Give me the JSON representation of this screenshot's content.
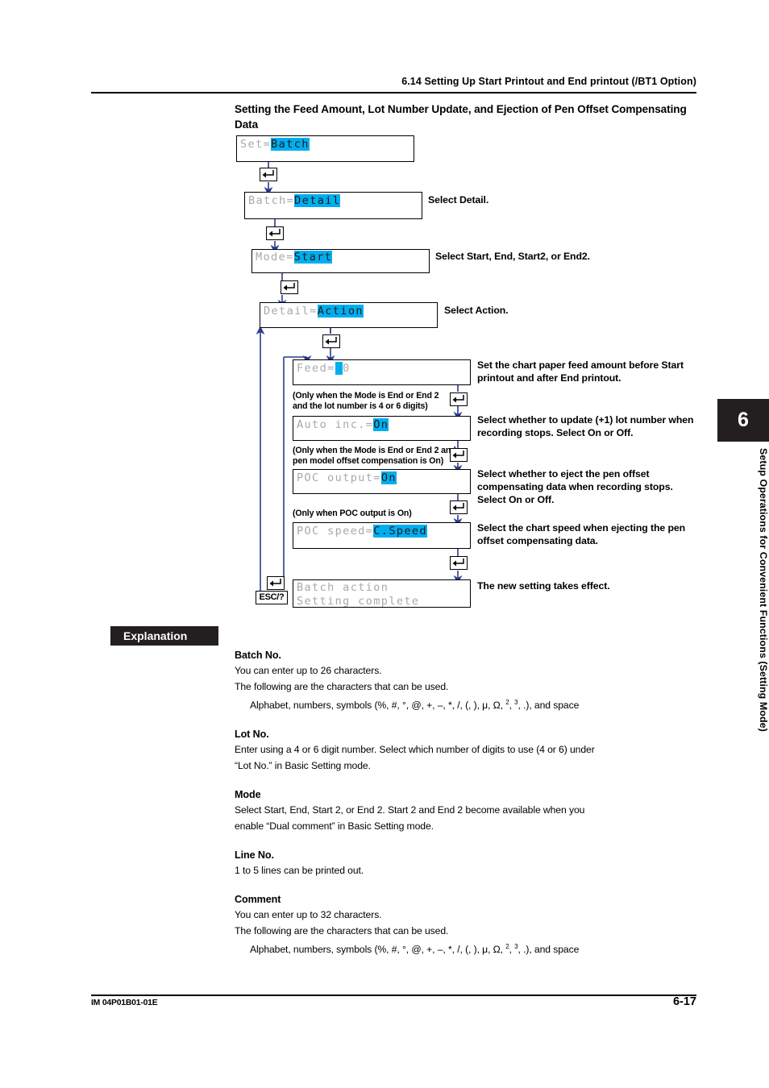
{
  "header": {
    "title": "6.14  Setting Up Start Printout and End printout (/BT1 Option)"
  },
  "section": {
    "title": "Setting the Feed Amount, Lot Number Update, and Ejection of Pen Offset Compensating Data"
  },
  "flow": {
    "steps": [
      {
        "id": "set",
        "lcd_prefix": "Set=",
        "lcd_value": "Batch",
        "callout": ""
      },
      {
        "id": "batch",
        "lcd_prefix": "Batch=",
        "lcd_value": "Detail",
        "callout": "Select Detail."
      },
      {
        "id": "mode",
        "lcd_prefix": "Mode=",
        "lcd_value": "Start",
        "callout": "Select Start, End, Start2, or End2."
      },
      {
        "id": "detail",
        "lcd_prefix": "Detail=",
        "lcd_value": "Action",
        "callout": "Select Action."
      },
      {
        "id": "feed",
        "lcd_prefix": "Feed=",
        "lcd_cursor": " ",
        "lcd_suffix": "0",
        "callout": "Set the chart paper feed amount before Start printout and after End printout."
      },
      {
        "id": "auto-inc",
        "lcd_prefix": "Auto inc.=",
        "lcd_value": "On",
        "note": "(Only when the Mode is End or End 2 and the lot number is 4 or 6 digits)",
        "callout": "Select whether to update (+1) lot number when recording stops. Select On or Off."
      },
      {
        "id": "poc-output",
        "lcd_prefix": "POC output=",
        "lcd_value": "On",
        "note": "(Only when the Mode is End or End 2 and pen model offset compensation is On)",
        "callout": "Select whether to eject the pen offset compensating data when recording stops. Select On or Off."
      },
      {
        "id": "poc-speed",
        "lcd_prefix": "POC speed=",
        "lcd_value": "C.Speed",
        "note": "(Only when POC output is On)",
        "callout": "Select the chart speed when ejecting the pen offset compensating data."
      },
      {
        "id": "complete",
        "lcd_line1": "Batch action",
        "lcd_line2": "Setting complete",
        "callout": "The new setting takes effect."
      }
    ],
    "esc_key_label": "ESC/?",
    "enter_key_name": "enter-key",
    "highlight_color": "#00aeef"
  },
  "explanation": {
    "tag": "Explanation",
    "blocks": [
      {
        "heading": "Batch No.",
        "lines": [
          "You can enter up to 26 characters.",
          "The following are the characters that can be used."
        ],
        "indented_prefix": "Alphabet, numbers, symbols (%, #, °, @, +, –, *, /, (, ), μ, Ω, ",
        "indented_sup1": "2",
        "indented_mid": ", ",
        "indented_sup2": "3",
        "indented_suffix": ", .), and space"
      },
      {
        "heading": "Lot No.",
        "lines": [
          "Enter using a 4 or 6 digit number. Select which number of digits to use (4 or 6) under",
          "“Lot No.” in Basic Setting mode."
        ]
      },
      {
        "heading": "Mode",
        "lines": [
          "Select Start, End, Start 2, or End 2. Start 2 and End 2 become available when you",
          "enable “Dual comment” in Basic Setting mode."
        ]
      },
      {
        "heading": "Line No.",
        "lines": [
          "1 to 5 lines can be printed out."
        ]
      },
      {
        "heading": "Comment",
        "lines": [
          "You can enter up to 32 characters.",
          "The following are the characters that can be used."
        ],
        "indented_prefix": "Alphabet, numbers, symbols (%, #, °, @, +, –, *, /, (, ), μ, Ω, ",
        "indented_sup1": "2",
        "indented_mid": ", ",
        "indented_sup2": "3",
        "indented_suffix": ", .), and space"
      }
    ]
  },
  "chapter": {
    "number": "6",
    "vertical_title": "Setup Operations for Convenient Functions (Setting Mode)"
  },
  "footer": {
    "left": "IM 04P01B01-01E",
    "right": "6-17"
  }
}
